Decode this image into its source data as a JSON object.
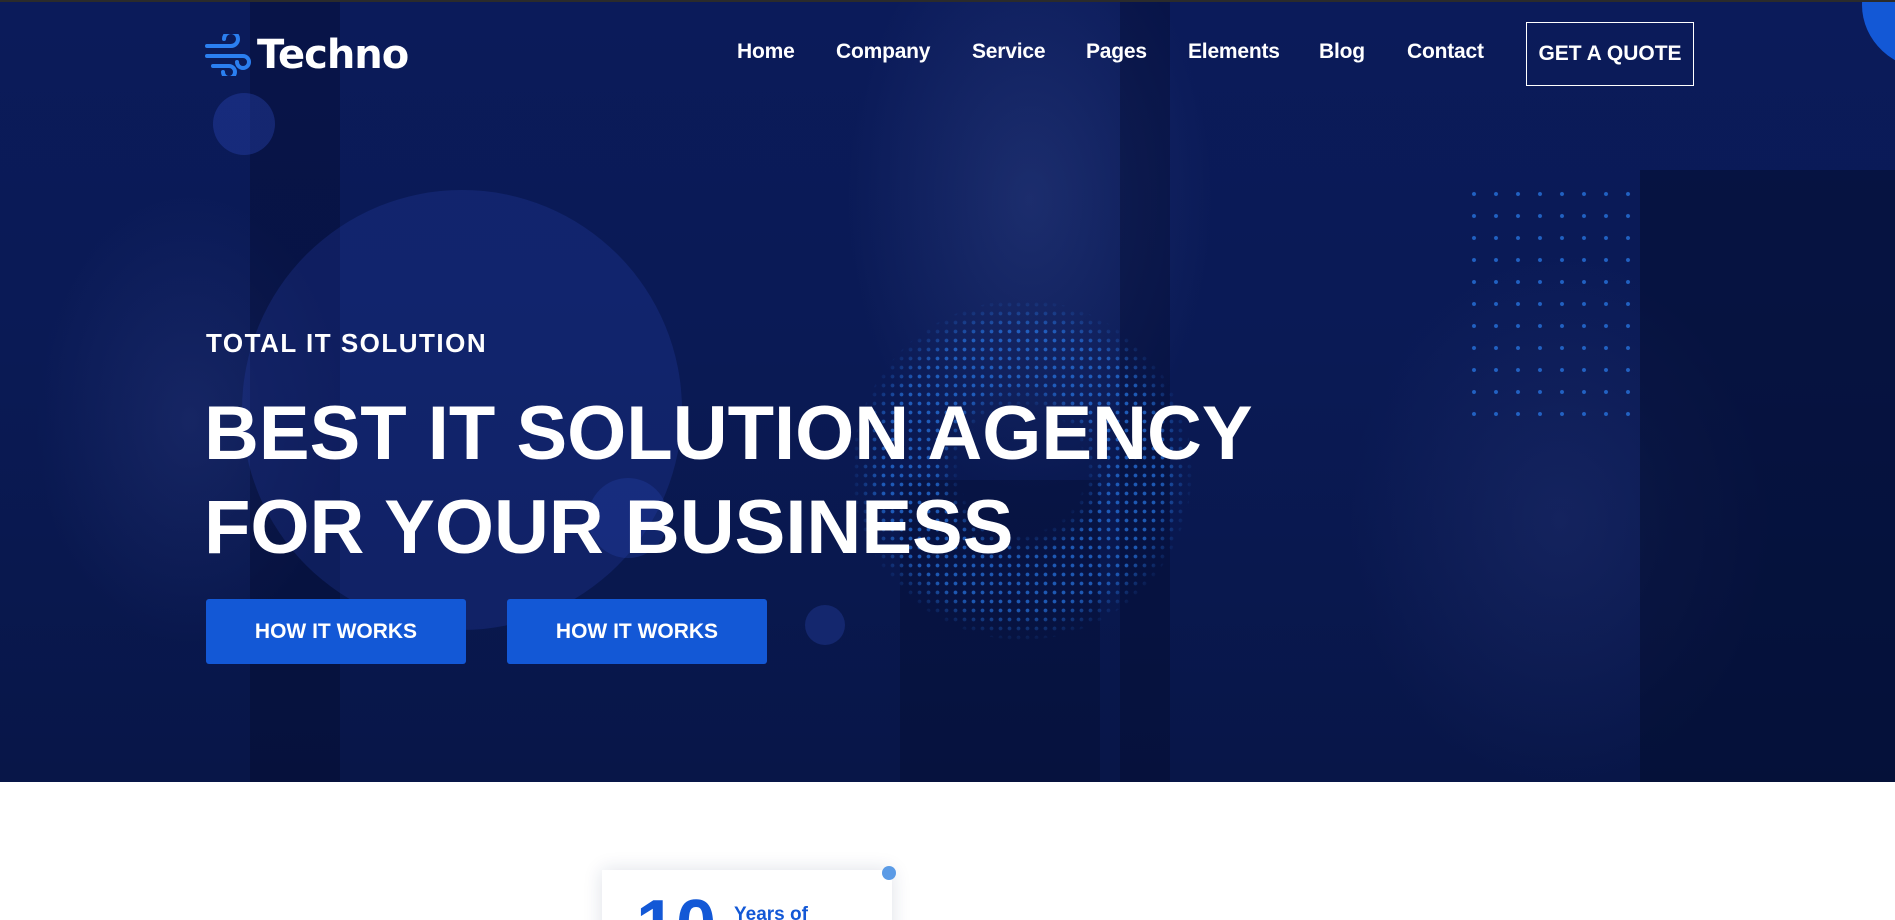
{
  "brand": {
    "name": "Techno",
    "accent": "#1358d6",
    "hero_bg": "#0b1b5a"
  },
  "nav": {
    "items": [
      "Home",
      "Company",
      "Service",
      "Pages",
      "Elements",
      "Blog",
      "Contact"
    ],
    "quote_label": "GET A QUOTE"
  },
  "hero": {
    "kicker": "TOTAL IT SOLUTION",
    "headline_line1": "BEST IT SOLUTION AGENCY",
    "headline_line2": "FOR YOUR BUSINESS",
    "buttons": [
      "HOW IT WORKS",
      "HOW IT WORKS"
    ]
  },
  "stats": {
    "number": "10",
    "label": "Years of"
  },
  "icons": [
    "wind-logo-icon"
  ]
}
